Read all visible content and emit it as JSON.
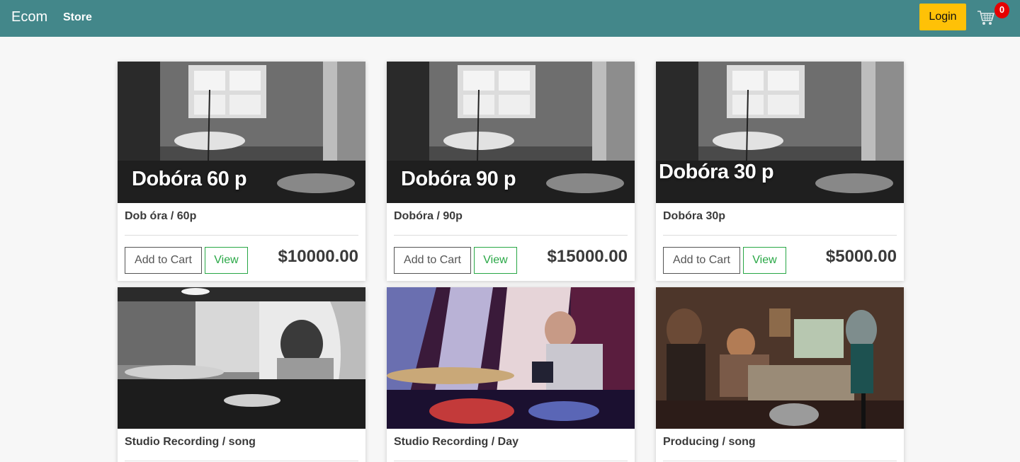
{
  "navbar": {
    "brand": "Ecom",
    "store_link": "Store",
    "login_label": "Login",
    "cart_count": "0",
    "accent": "#43878a",
    "login_color": "#ffc107"
  },
  "products": [
    {
      "thumb_text": "Dobóra 60 p",
      "title": "Dob óra / 60p",
      "price": "$10000.00",
      "add_label": "Add to Cart",
      "view_label": "View"
    },
    {
      "thumb_text": "Dobóra 90 p",
      "title": "Dobóra / 90p",
      "price": "$15000.00",
      "add_label": "Add to Cart",
      "view_label": "View"
    },
    {
      "thumb_text": "Dobóra 30 p",
      "title": "Dobóra 30p",
      "price": "$5000.00",
      "add_label": "Add to Cart",
      "view_label": "View"
    },
    {
      "title": "Studio Recording / song"
    },
    {
      "title": "Studio Recording / Day"
    },
    {
      "title": "Producing / song"
    }
  ]
}
